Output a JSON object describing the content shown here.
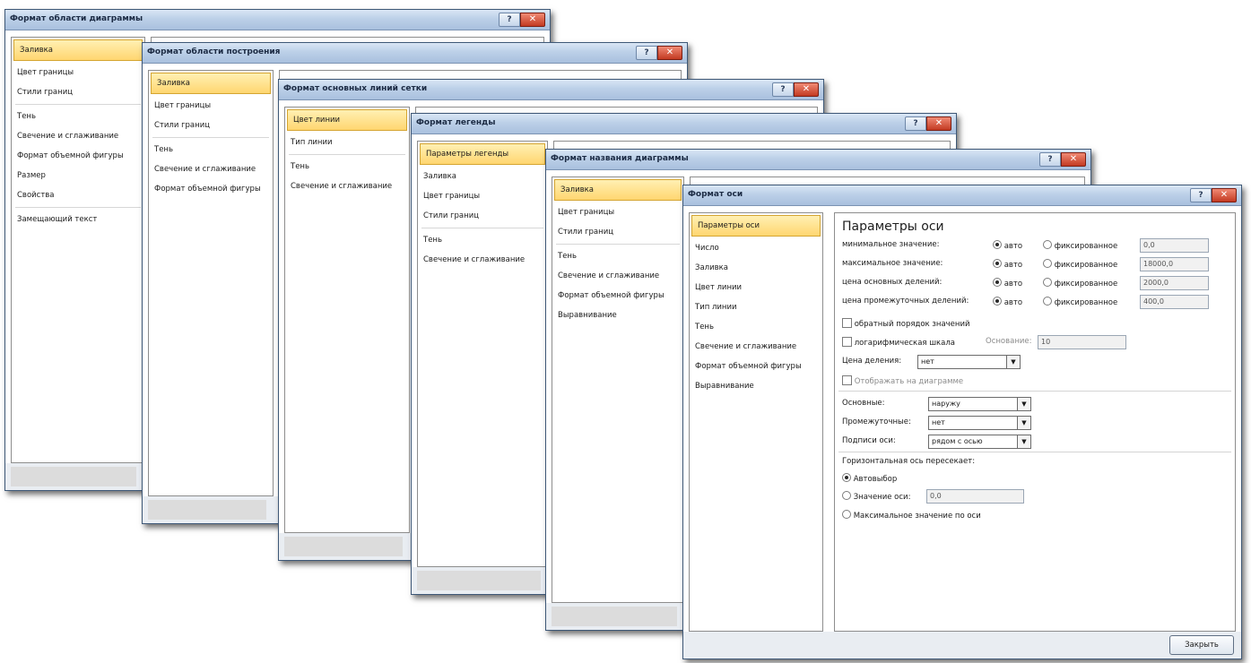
{
  "windows": [
    {
      "title": "Формат области диаграммы",
      "nav": [
        {
          "label": "Заливка",
          "selected": true
        },
        {
          "label": "Цвет границы"
        },
        {
          "label": "Стили границ",
          "sep_after": true
        },
        {
          "label": "Тень"
        },
        {
          "label": "Свечение и сглаживание"
        },
        {
          "label": "Формат объемной фигуры"
        },
        {
          "label": "Размер"
        },
        {
          "label": "Свойства",
          "sep_after": true
        },
        {
          "label": "Замещающий текст"
        }
      ]
    },
    {
      "title": "Формат области построения",
      "nav": [
        {
          "label": "Заливка",
          "selected": true
        },
        {
          "label": "Цвет границы"
        },
        {
          "label": "Стили границ",
          "sep_after": true
        },
        {
          "label": "Тень"
        },
        {
          "label": "Свечение и сглаживание"
        },
        {
          "label": "Формат объемной фигуры"
        }
      ]
    },
    {
      "title": "Формат основных линий сетки",
      "nav": [
        {
          "label": "Цвет линии",
          "selected": true
        },
        {
          "label": "Тип линии",
          "sep_after": true
        },
        {
          "label": "Тень"
        },
        {
          "label": "Свечение и сглаживание"
        }
      ]
    },
    {
      "title": "Формат легенды",
      "nav": [
        {
          "label": "Параметры легенды",
          "selected": true
        },
        {
          "label": "Заливка"
        },
        {
          "label": "Цвет границы"
        },
        {
          "label": "Стили границ",
          "sep_after": true
        },
        {
          "label": "Тень"
        },
        {
          "label": "Свечение и сглаживание"
        }
      ]
    },
    {
      "title": "Формат названия диаграммы",
      "nav": [
        {
          "label": "Заливка",
          "selected": true
        },
        {
          "label": "Цвет границы"
        },
        {
          "label": "Стили границ",
          "sep_after": true
        },
        {
          "label": "Тень"
        },
        {
          "label": "Свечение и сглаживание"
        },
        {
          "label": "Формат объемной фигуры"
        },
        {
          "label": "Выравнивание"
        }
      ]
    },
    {
      "title": "Формат оси",
      "nav": [
        {
          "label": "Параметры оси",
          "selected": true
        },
        {
          "label": "Число"
        },
        {
          "label": "Заливка"
        },
        {
          "label": "Цвет линии"
        },
        {
          "label": "Тип линии"
        },
        {
          "label": "Тень"
        },
        {
          "label": "Свечение и сглаживание"
        },
        {
          "label": "Формат объемной фигуры"
        },
        {
          "label": "Выравнивание"
        }
      ]
    }
  ],
  "axis_panel": {
    "heading": "Параметры оси",
    "auto_label": "авто",
    "fixed_label": "фиксированное",
    "rows": [
      {
        "label": "минимальное значение:",
        "value": "0,0"
      },
      {
        "label": "максимальное значение:",
        "value": "18000,0"
      },
      {
        "label": "цена основных делений:",
        "value": "2000,0"
      },
      {
        "label": "цена промежуточных делений:",
        "value": "400,0"
      }
    ],
    "reverse_order": "обратный порядок значений",
    "log_scale": "логарифмическая шкала",
    "base_label": "Основание:",
    "base_value": "10",
    "display_units_label": "Цена деления:",
    "display_units_value": "нет",
    "show_on_chart": "Отображать на диаграмме",
    "major_label": "Основные:",
    "major_value": "наружу",
    "minor_label": "Промежуточные:",
    "minor_value": "нет",
    "axis_labels_label": "Подписи оси:",
    "axis_labels_value": "рядом с осью",
    "crosses_heading": "Горизонтальная ось пересекает:",
    "crosses_auto": "Автовыбор",
    "crosses_value_label": "Значение оси:",
    "crosses_value": "0,0",
    "crosses_max": "Максимальное значение по оси",
    "close_button": "Закрыть"
  },
  "colors": {
    "title_gradient": "#bcd0e8",
    "selection": "#ffd670",
    "close_btn": "#c33a22"
  }
}
